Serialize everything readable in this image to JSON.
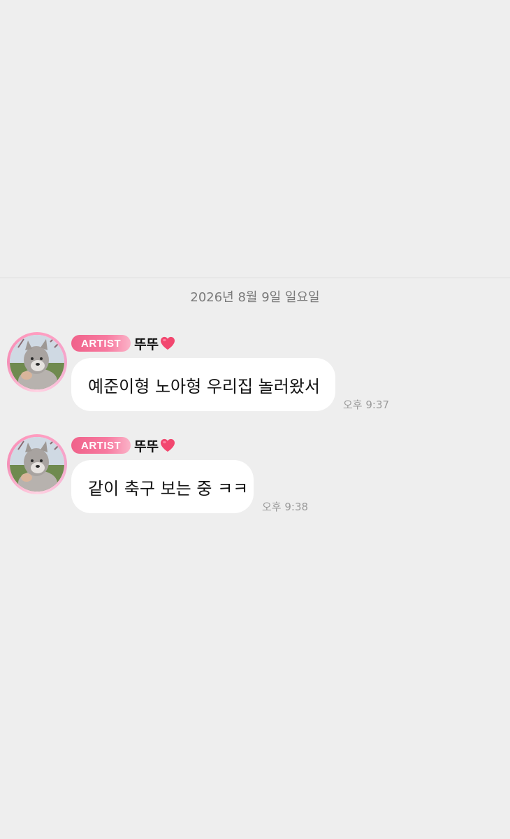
{
  "date_separator": "2026년 8월 9일 일요일",
  "messages": [
    {
      "badge": "ARTIST",
      "sender": "뚜뚜",
      "text": "예준이형 노아형 우리집 놀러왔서",
      "time": "오후 9:37"
    },
    {
      "badge": "ARTIST",
      "sender": "뚜뚜",
      "text": "같이 축구 보는 중 ㅋㅋ",
      "time": "오후 9:38"
    }
  ],
  "colors": {
    "background": "#eeeeee",
    "bubble": "#ffffff",
    "badge_gradient_start": "#f0628a",
    "badge_gradient_end": "#fbb3c8",
    "heart": "#f2476f",
    "avatar_ring": "#f4a6cc"
  },
  "icons": {
    "heart": "heart-icon",
    "avatar": "avatar-image"
  }
}
